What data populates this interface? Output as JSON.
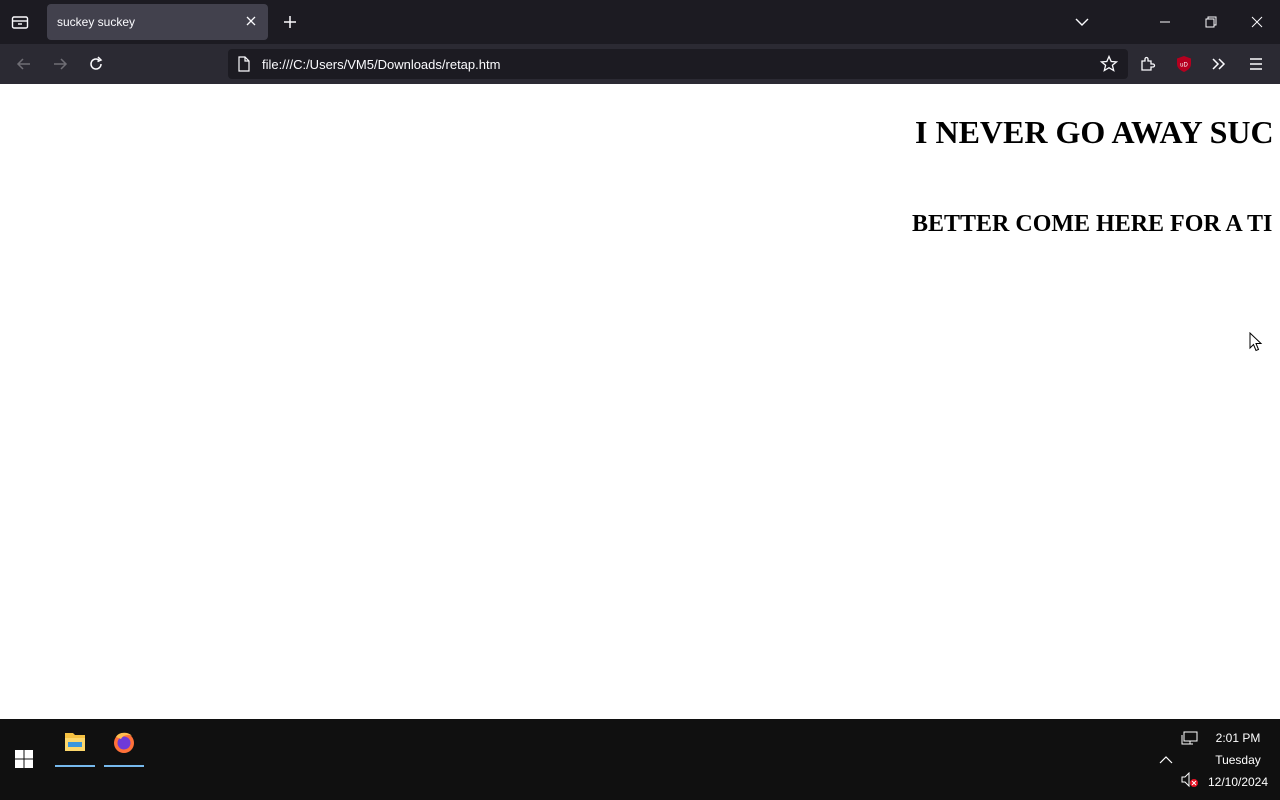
{
  "browser": {
    "tab_title": "suckey suckey",
    "url": "file:///C:/Users/VM5/Downloads/retap.htm"
  },
  "page": {
    "heading1": "I NEVER GO AWAY SUC",
    "heading2": "BETTER COME HERE FOR A TI"
  },
  "taskbar": {
    "time": "2:01 PM",
    "day": "Tuesday",
    "date": "12/10/2024"
  },
  "icons": {
    "tab_list": "tab-list-icon",
    "close_tab": "close-icon",
    "new_tab": "plus-icon",
    "list_all_tabs": "chevron-down-icon",
    "minimize": "minimize-icon",
    "restore": "restore-icon",
    "close": "close-icon",
    "back": "back-arrow-icon",
    "forward": "forward-arrow-icon",
    "reload": "reload-icon",
    "page": "page-icon",
    "bookmark": "star-icon",
    "extensions": "puzzle-icon",
    "ublock": "ublock-icon",
    "overflow": "double-chevron-icon",
    "menu": "hamburger-icon"
  },
  "colors": {
    "tab_active": "#42414d",
    "toolbar": "#2b2a33",
    "urlbar": "#1c1b22",
    "taskbar": "#101010",
    "taskbar_indicator": "#76b9ed"
  }
}
